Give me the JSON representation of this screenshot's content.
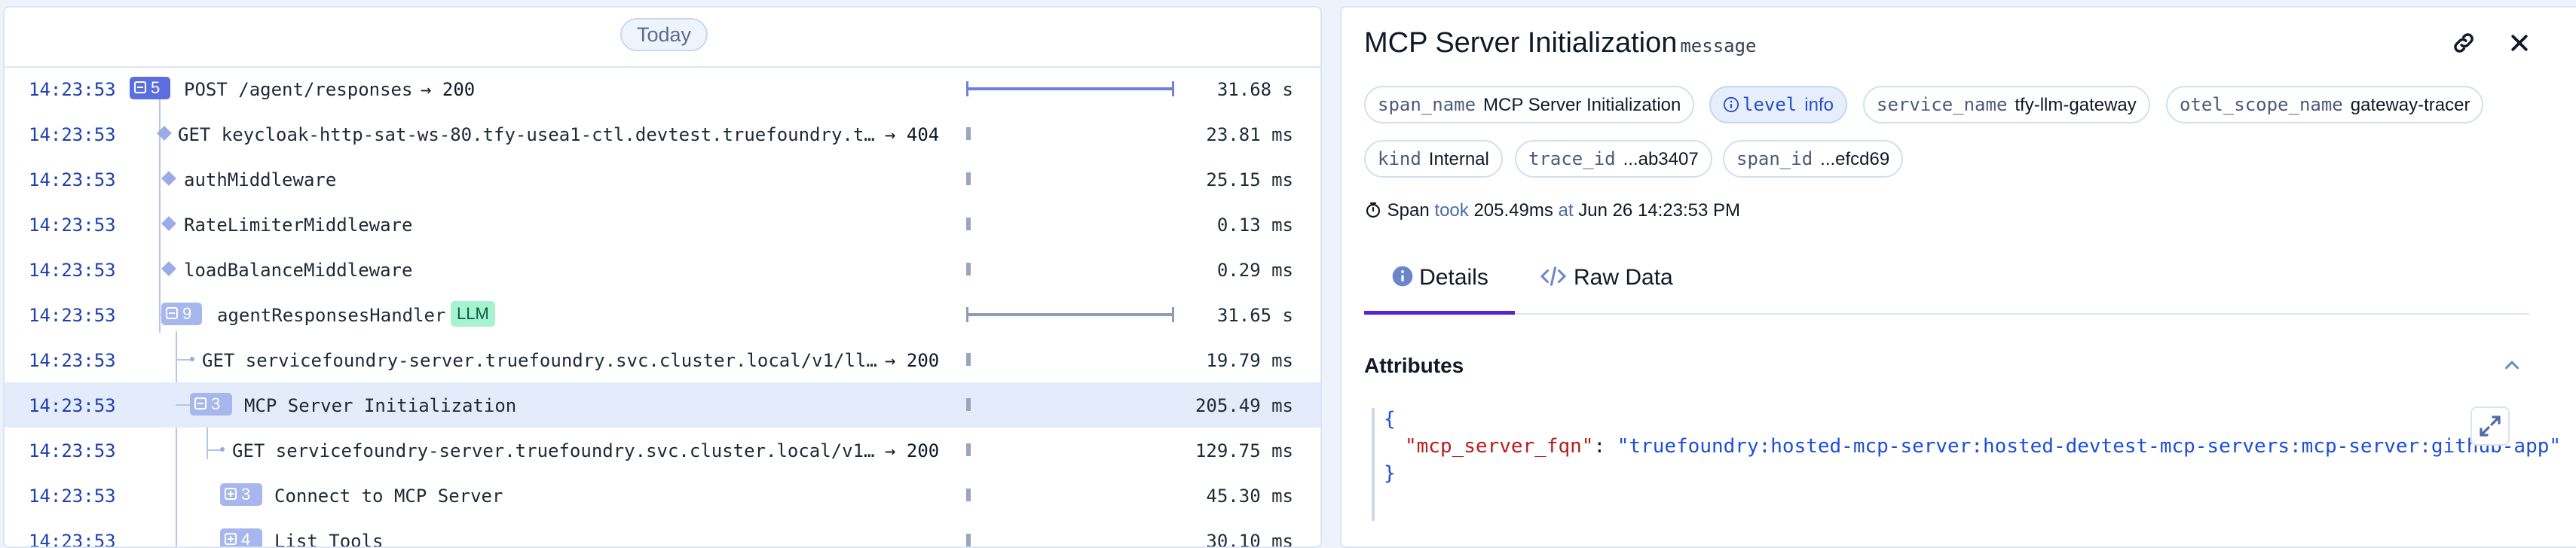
{
  "timeline": {
    "day_label": "Today",
    "rows": [
      {
        "time": "14:23:53",
        "badge": "5",
        "label": "POST /agent/responses",
        "status": "200",
        "duration": "31.68 s"
      },
      {
        "time": "14:23:53",
        "label": "GET keycloak-http-sat-ws-80.tfy-usea1-ctl.devtest.truefoundry.t…",
        "status": "404",
        "duration": "23.81 ms"
      },
      {
        "time": "14:23:53",
        "label": "authMiddleware",
        "duration": "25.15 ms"
      },
      {
        "time": "14:23:53",
        "label": "RateLimiterMiddleware",
        "duration": "0.13 ms"
      },
      {
        "time": "14:23:53",
        "label": "loadBalanceMiddleware",
        "duration": "0.29 ms"
      },
      {
        "time": "14:23:53",
        "badge": "9",
        "label": "agentResponsesHandler",
        "tag": "LLM",
        "duration": "31.65 s"
      },
      {
        "time": "14:23:53",
        "label": "GET servicefoundry-server.truefoundry.svc.cluster.local/v1/ll…",
        "status": "200",
        "duration": "19.79 ms"
      },
      {
        "time": "14:23:53",
        "badge": "3",
        "label": "MCP Server Initialization",
        "duration": "205.49 ms",
        "selected": true
      },
      {
        "time": "14:23:53",
        "label": "GET servicefoundry-server.truefoundry.svc.cluster.local/v1…",
        "status": "200",
        "duration": "129.75 ms"
      },
      {
        "time": "14:23:53",
        "badge": "3",
        "label": "Connect to MCP Server",
        "duration": "45.30 ms"
      },
      {
        "time": "14:23:53",
        "badge": "4",
        "label": "List Tools",
        "duration": "30.10 ms"
      }
    ]
  },
  "detail": {
    "title": "MCP Server Initialization",
    "subtitle": "message",
    "chips": [
      {
        "key": "span_name",
        "value": "MCP Server Initialization"
      },
      {
        "key": "level",
        "value": "info"
      },
      {
        "key": "service_name",
        "value": "tfy-llm-gateway"
      },
      {
        "key": "otel_scope_name",
        "value": "gateway-tracer"
      },
      {
        "key": "kind",
        "value": "Internal"
      },
      {
        "key": "trace_id",
        "value": "...ab3407"
      },
      {
        "key": "span_id",
        "value": "...efcd69"
      }
    ],
    "span_info": {
      "prefix": "Span",
      "took": "took",
      "duration": "205.49ms",
      "at": "at",
      "timestamp": "Jun 26 14:23:53 PM"
    },
    "tabs": [
      "Details",
      "Raw Data"
    ],
    "attributes_title": "Attributes",
    "attributes": {
      "key": "\"mcp_server_fqn\"",
      "value": "\"truefoundry:hosted-mcp-server:hosted-devtest-mcp-servers:mcp-server:github-app\""
    }
  },
  "colors": {
    "accent": "#5b21d6",
    "badge_dark": "#5b6ee0",
    "badge_light": "#a7b6ec",
    "llm_tag": "#a7f3d0",
    "selected_row": "#e4ebfa"
  },
  "icons": [
    "link-icon",
    "close-icon",
    "info-icon",
    "timer-icon",
    "code-icon",
    "chevron-up-icon",
    "expand-icon"
  ]
}
